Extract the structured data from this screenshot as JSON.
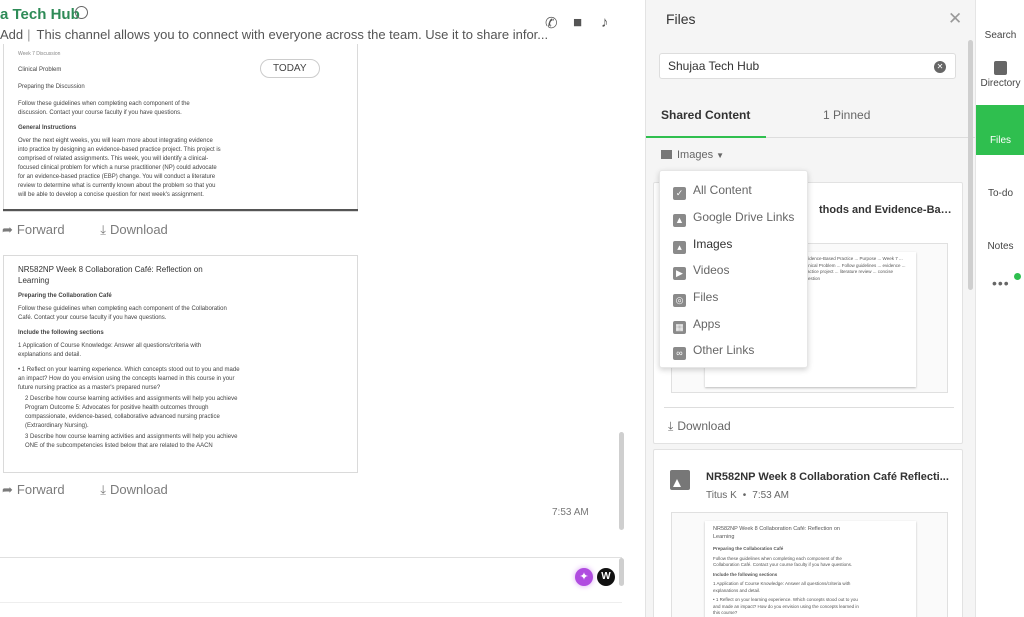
{
  "colors": {
    "accent": "#2fbf4f",
    "channel_title": "#2e8b57"
  },
  "chat": {
    "channel_name": "a Tech Hub",
    "add_label": "Add",
    "description": "This channel allows you to connect with everyone across the team. Use it to share infor...",
    "date_pill": "TODAY",
    "timestamp": "7:53 AM",
    "compose_badge": "W",
    "header_icons": [
      "phone-icon",
      "video-icon",
      "bell-icon"
    ],
    "message1": {
      "lines": {
        "top": "Week 7 Discussion",
        "l1": "Clinical Problem",
        "l2": "Preparing the Discussion",
        "l3": "Follow these guidelines when completing each component of the discussion. Contact your course faculty if you have questions.",
        "h1": "General Instructions",
        "body": "Over the next eight weeks, you will learn more about integrating evidence into practice by designing an evidence-based practice project. This project is comprised of related assignments. This week, you will identify a clinical-focused clinical problem for which a nurse practitioner (NP) could advocate for an evidence-based practice (EBP) change. You will conduct a literature review to determine what is currently known about the problem so that you will be able to develop a concise question for next week's assignment."
      },
      "forward": "Forward",
      "download": "Download"
    },
    "message2": {
      "title": "NR582NP Week 8 Collaboration Café: Reflection on Learning",
      "h1": "Preparing the Collaboration Café",
      "p1": "Follow these guidelines when completing each component of the Collaboration Café. Contact your course faculty if you have questions.",
      "h2": "Include the following sections",
      "item1": "1  Application of Course Knowledge: Answer all questions/criteria with explanations and detail.",
      "item2": "•  1  Reflect on your learning experience. Which concepts stood out to you and made an impact? How do you envision using the concepts learned in this course in your future nursing practice as a master's prepared nurse?",
      "item3": "2  Describe how course learning activities and assignments will help you achieve Program Outcome 5: Advocates for positive health outcomes through compassionate, evidence-based, collaborative advanced nursing practice (Extraordinary Nursing).",
      "item4": "3  Describe how course learning activities and assignments will help you achieve ONE of the subcompetencies listed below that are related to the AACN",
      "forward": "Forward",
      "download": "Download"
    }
  },
  "files": {
    "title": "Files",
    "search_value": "Shujaa Tech Hub",
    "tabs": {
      "shared": "Shared Content",
      "pinned": "1 Pinned"
    },
    "filter_label": "Images",
    "card1": {
      "title": "thods and Evidence-Base...",
      "thumb_text": "Evidence-Based Practice ... Purpose ... Week 7 ... Clinical Problem ... Follow guidelines ... evidence ... practice project ... literature review ... concise question",
      "download": "Download"
    },
    "card2": {
      "title": "NR582NP Week 8 Collaboration Café Reflecti...",
      "author": "Titus K",
      "time": "7:53 AM",
      "thumb_title": "NR582NP Week 8 Collaboration Café: Reflection on Learning",
      "thumb_h1": "Preparing the Collaboration Café",
      "thumb_p1": "Follow these guidelines when completing each component of the Collaboration Café. Contact your course faculty if you have questions.",
      "thumb_h2": "Include the following sections",
      "thumb_item1": "1  Application of Course Knowledge: Answer all questions/criteria with explanations and detail.",
      "thumb_item2": "•  1  Reflect on your learning experience. Which concepts stood out to you and made an impact? How do you envision using the concepts learned in this course?"
    },
    "dropdown": [
      {
        "label": "All Content",
        "icon": "check-square-icon"
      },
      {
        "label": "Google Drive Links",
        "icon": "drive-icon"
      },
      {
        "label": "Images",
        "icon": "image-icon"
      },
      {
        "label": "Videos",
        "icon": "play-icon"
      },
      {
        "label": "Files",
        "icon": "paperclip-icon"
      },
      {
        "label": "Apps",
        "icon": "apps-grid-icon"
      },
      {
        "label": "Other Links",
        "icon": "link-icon"
      }
    ]
  },
  "rail": {
    "search": "Search",
    "directory": "Directory",
    "files": "Files",
    "todo": "To-do",
    "notes": "Notes",
    "more": "•••"
  }
}
